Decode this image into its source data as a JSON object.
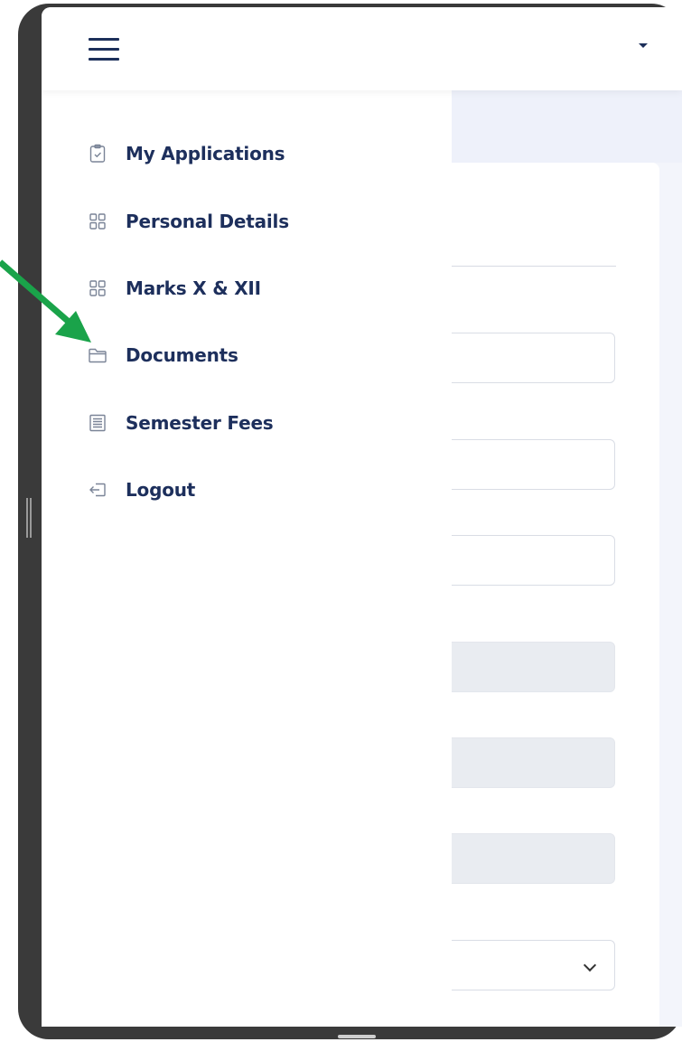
{
  "header": {
    "menu_icon": "hamburger-icon",
    "profile_caret_icon": "caret-down-icon"
  },
  "drawer": {
    "items": [
      {
        "label": "My Applications",
        "icon": "clipboard-check-icon"
      },
      {
        "label": "Personal Details",
        "icon": "grid-icon"
      },
      {
        "label": "Marks X & XII",
        "icon": "grid-icon"
      },
      {
        "label": "Documents",
        "icon": "folder-icon"
      },
      {
        "label": "Semester Fees",
        "icon": "list-document-icon"
      },
      {
        "label": "Logout",
        "icon": "logout-icon"
      }
    ]
  },
  "annotation": {
    "arrow_color": "#1aa34a",
    "arrow_icon": "green-arrow-icon"
  },
  "colors": {
    "accent": "#1d2f5c",
    "drawer_bg": "#ffffff",
    "page_bg": "#f3f5fb"
  }
}
